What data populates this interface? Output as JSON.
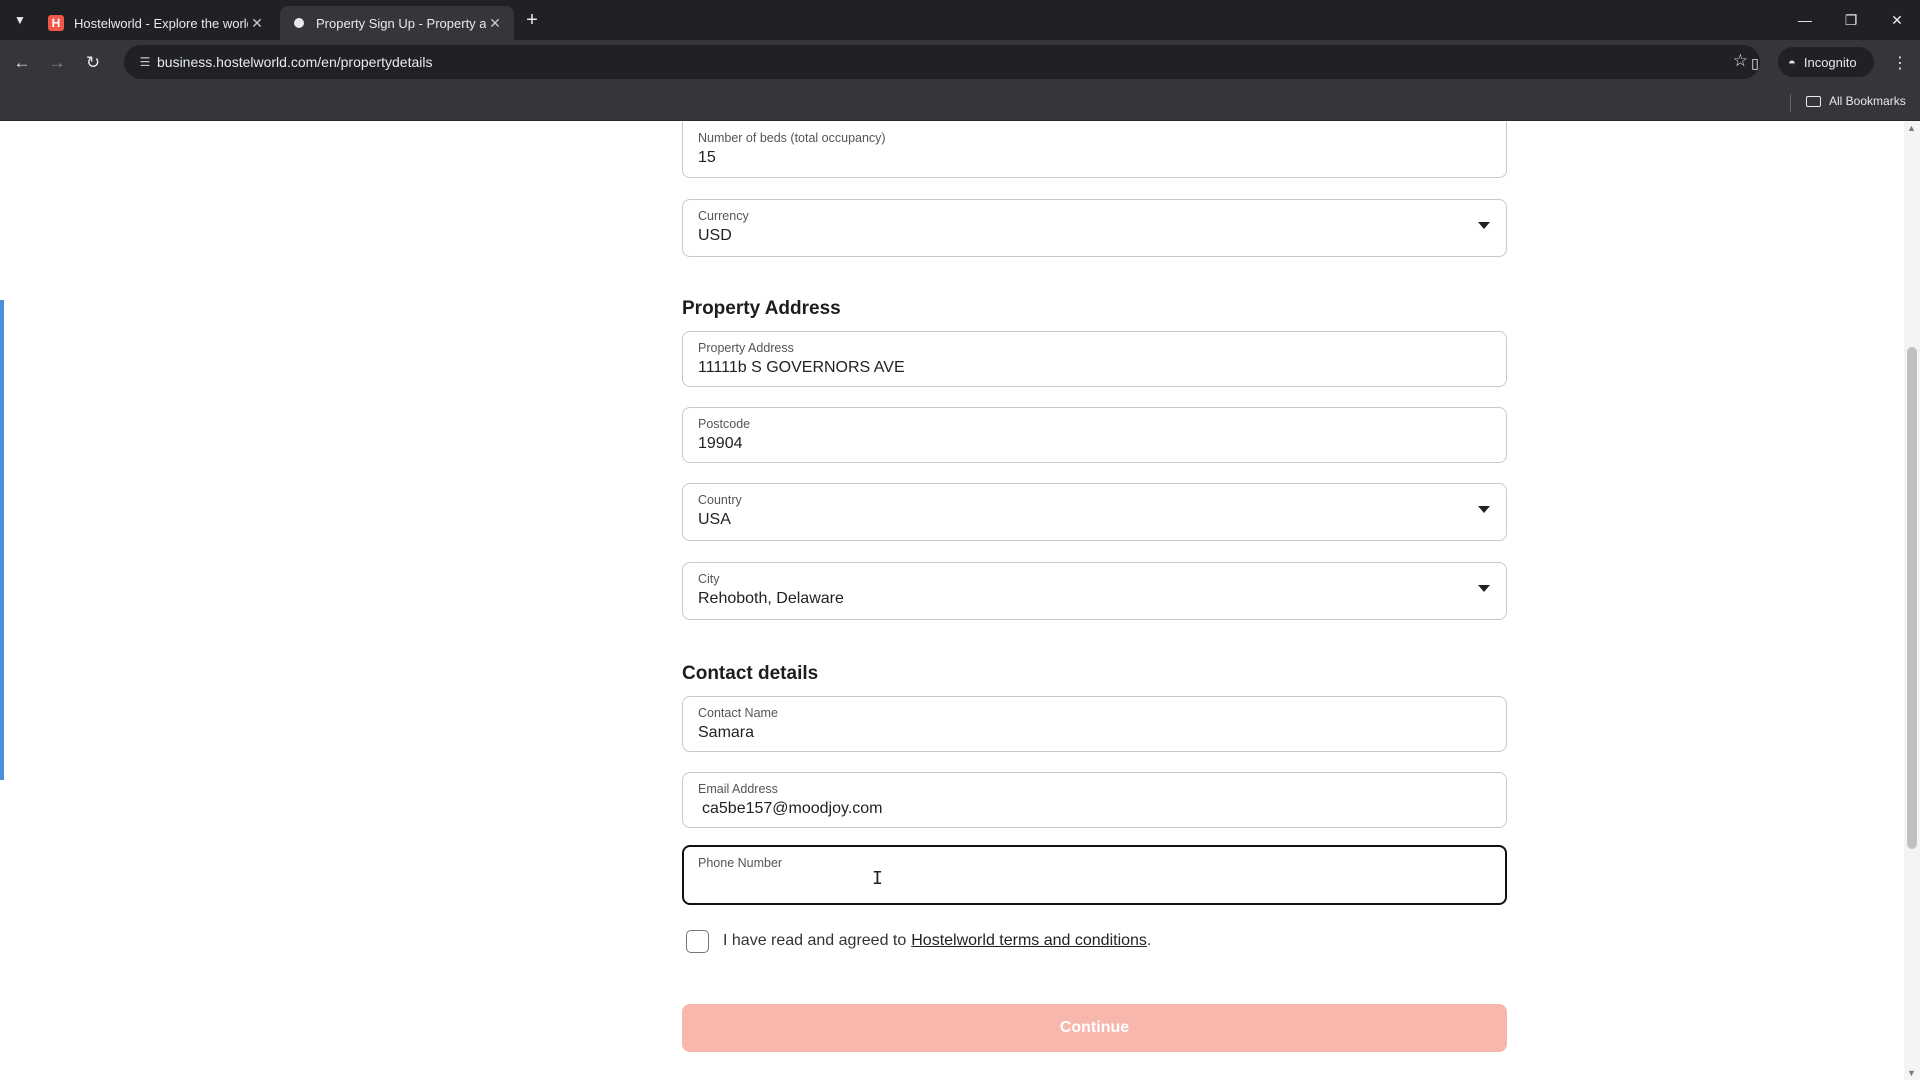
{
  "browser": {
    "tabs": [
      {
        "title": "Hostelworld - Explore the world",
        "favicon": "H",
        "active": false
      },
      {
        "title": "Property Sign Up - Property and",
        "active": true
      }
    ],
    "url": "business.hostelworld.com/en/propertydetails",
    "incognito_label": "Incognito",
    "bookmarks_label": "All Bookmarks"
  },
  "form": {
    "beds": {
      "label": "Number of beds (total occupancy)",
      "value": "15"
    },
    "currency": {
      "label": "Currency",
      "value": "USD"
    },
    "address_section_title": "Property Address",
    "address": {
      "label": "Property Address",
      "value": "11111b S GOVERNORS AVE"
    },
    "postcode": {
      "label": "Postcode",
      "value": "19904"
    },
    "country": {
      "label": "Country",
      "value": "USA"
    },
    "city": {
      "label": "City",
      "value": "Rehoboth, Delaware"
    },
    "contact_section_title": "Contact details",
    "contact_name": {
      "label": "Contact Name",
      "value": "Samara"
    },
    "email": {
      "label": "Email Address",
      "value": "ca5be157@moodjoy.com"
    },
    "phone": {
      "label": "Phone Number",
      "value": ""
    },
    "terms_text": "I have read and agreed to",
    "terms_link": "Hostelworld terms and conditions",
    "terms_period": ".",
    "continue_label": "Continue"
  },
  "colors": {
    "continue_button": "#f8b7ad",
    "accent_bar": "#4a90d9"
  }
}
